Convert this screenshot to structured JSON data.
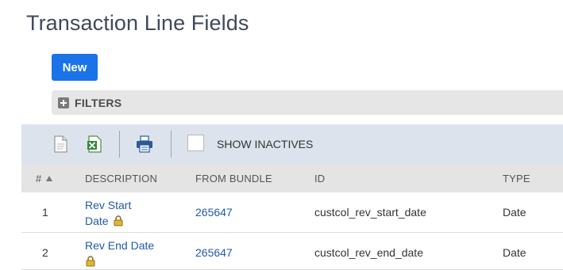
{
  "page": {
    "title": "Transaction Line Fields"
  },
  "actions": {
    "new_label": "New"
  },
  "filters": {
    "label": "FILTERS"
  },
  "toolbar": {
    "icons": [
      "document-icon",
      "excel-icon",
      "print-icon"
    ],
    "show_inactives_label": "SHOW INACTIVES",
    "show_inactives_checked": false
  },
  "table": {
    "columns": [
      "#",
      "DESCRIPTION",
      "FROM BUNDLE",
      "ID",
      "TYPE"
    ],
    "rows": [
      {
        "num": "1",
        "description_line1": "Rev Start",
        "description_line2": "Date",
        "locked": true,
        "bundle": "265647",
        "id": "custcol_rev_start_date",
        "type": "Date"
      },
      {
        "num": "2",
        "description_line1": "Rev End Date",
        "description_line2": "",
        "locked": true,
        "bundle": "265647",
        "id": "custcol_rev_end_date",
        "type": "Date"
      }
    ]
  },
  "colors": {
    "primary": "#1a73e8",
    "link": "#215aa8",
    "toolbar_bg": "#dde3ec"
  }
}
